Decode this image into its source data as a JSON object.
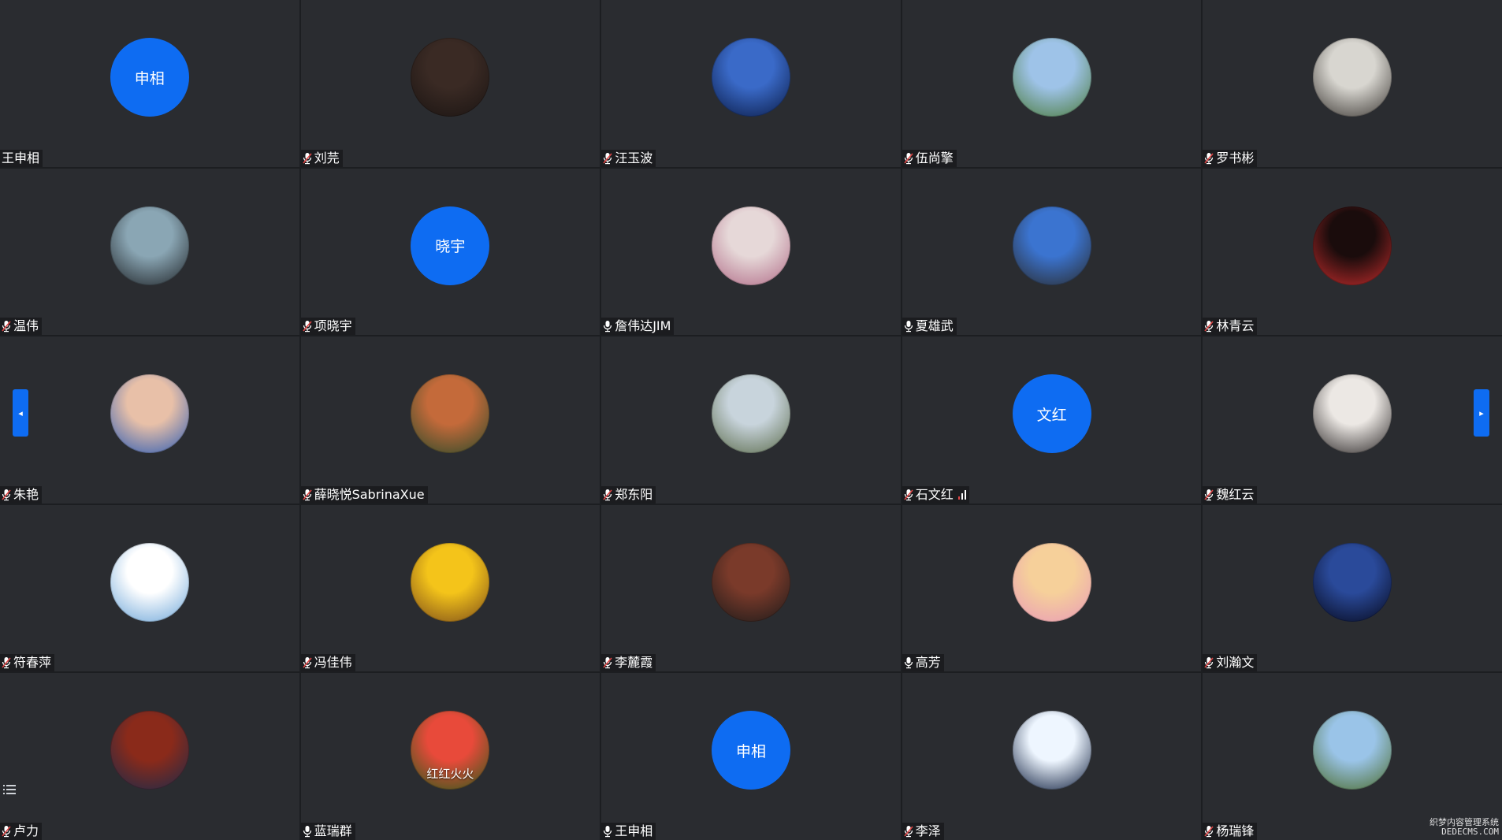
{
  "colors": {
    "tile_bg": "#2a2c30",
    "accent_blue": "#0e6cf2",
    "nameplate_text": "#ffffff",
    "mic_muted_red": "#e04646"
  },
  "participants": [
    {
      "name": "王申相",
      "mic": "none",
      "avatar": {
        "type": "initials",
        "text": "申相"
      }
    },
    {
      "name": "刘芫",
      "mic": "muted",
      "avatar": {
        "type": "photo",
        "colors": [
          "#3a2a24",
          "#1a1412"
        ]
      }
    },
    {
      "name": "汪玉波",
      "mic": "muted",
      "avatar": {
        "type": "photo",
        "colors": [
          "#3a6ac8",
          "#0a1a44"
        ]
      }
    },
    {
      "name": "伍尚擎",
      "mic": "muted",
      "avatar": {
        "type": "photo",
        "colors": [
          "#9ec3e8",
          "#4a7a3a"
        ]
      }
    },
    {
      "name": "罗书彬",
      "mic": "muted",
      "avatar": {
        "type": "photo",
        "colors": [
          "#d8d6d0",
          "#3a3632"
        ]
      }
    },
    {
      "name": "温伟",
      "mic": "muted",
      "avatar": {
        "type": "photo",
        "colors": [
          "#8aa6b4",
          "#1e2226"
        ]
      }
    },
    {
      "name": "项晓宇",
      "mic": "muted",
      "avatar": {
        "type": "initials",
        "text": "晓宇"
      }
    },
    {
      "name": "詹伟达JIM",
      "mic": "on",
      "avatar": {
        "type": "photo",
        "colors": [
          "#e6d8d8",
          "#b06a86"
        ]
      }
    },
    {
      "name": "夏雄武",
      "mic": "on",
      "avatar": {
        "type": "photo",
        "colors": [
          "#3b74d0",
          "#2a2a2a"
        ]
      }
    },
    {
      "name": "林青云",
      "mic": "muted",
      "avatar": {
        "type": "photo",
        "colors": [
          "#1a0c0c",
          "#c42c2c"
        ]
      }
    },
    {
      "name": "朱艳",
      "mic": "muted",
      "avatar": {
        "type": "photo",
        "colors": [
          "#e8c0a8",
          "#2a5ab4"
        ]
      }
    },
    {
      "name": "薛晓悦SabrinaXue",
      "mic": "muted",
      "avatar": {
        "type": "photo",
        "colors": [
          "#c46a3a",
          "#2a4a2a"
        ]
      }
    },
    {
      "name": "郑东阳",
      "mic": "muted",
      "avatar": {
        "type": "photo",
        "colors": [
          "#c8d4dc",
          "#5a6a4a"
        ]
      }
    },
    {
      "name": "石文红",
      "mic": "muted",
      "avatar": {
        "type": "initials",
        "text": "文红"
      },
      "signal": true
    },
    {
      "name": "魏红云",
      "mic": "muted",
      "avatar": {
        "type": "photo",
        "colors": [
          "#ece8e4",
          "#2a2626"
        ]
      }
    },
    {
      "name": "符春萍",
      "mic": "muted",
      "avatar": {
        "type": "photo",
        "colors": [
          "#ffffff",
          "#6aa4d8"
        ]
      }
    },
    {
      "name": "冯佳伟",
      "mic": "muted",
      "avatar": {
        "type": "photo",
        "colors": [
          "#f4c41a",
          "#7a4a1a"
        ]
      }
    },
    {
      "name": "李麓霞",
      "mic": "muted",
      "avatar": {
        "type": "photo",
        "colors": [
          "#7a3a2a",
          "#1a1a1a"
        ]
      }
    },
    {
      "name": "高芳",
      "mic": "on",
      "avatar": {
        "type": "photo",
        "colors": [
          "#f6d09a",
          "#e89ab8"
        ]
      }
    },
    {
      "name": "刘瀚文",
      "mic": "muted",
      "avatar": {
        "type": "photo",
        "colors": [
          "#2a4a9a",
          "#06081a"
        ]
      }
    },
    {
      "name": "卢力",
      "mic": "muted",
      "avatar": {
        "type": "photo",
        "colors": [
          "#8a2a1a",
          "#1a2a4a"
        ]
      }
    },
    {
      "name": "蓝瑞群",
      "mic": "on",
      "avatar": {
        "type": "photo",
        "colors": [
          "#e84a3a",
          "#2a5a1a"
        ],
        "overlay": "红红火火"
      }
    },
    {
      "name": "王申相",
      "mic": "on",
      "avatar": {
        "type": "initials",
        "text": "申相"
      }
    },
    {
      "name": "李泽",
      "mic": "muted",
      "avatar": {
        "type": "photo",
        "colors": [
          "#eef6ff",
          "#0a1a3a"
        ]
      }
    },
    {
      "name": "杨瑞锋",
      "mic": "muted",
      "avatar": {
        "type": "photo",
        "colors": [
          "#9ac4e8",
          "#4a6a2a"
        ]
      }
    }
  ],
  "controls": {
    "prev_page_glyph": "◂",
    "next_page_glyph": "▸"
  },
  "watermark": {
    "line1": "织梦内容管理系统",
    "line2": "DEDECMS.COM"
  }
}
